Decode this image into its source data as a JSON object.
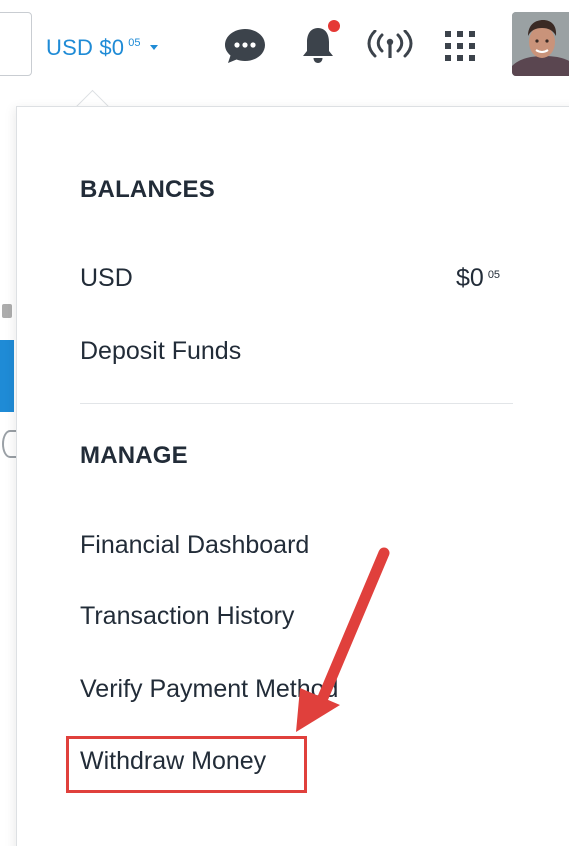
{
  "header": {
    "currency_label": "USD $0",
    "currency_cents": "05",
    "icons": [
      "chat-icon",
      "bell-icon",
      "signal-icon",
      "apps-icon",
      "avatar"
    ],
    "notification_dot_color": "#e53935"
  },
  "menu": {
    "balances_heading": "BALANCES",
    "usd_label": "USD",
    "usd_balance": "$0",
    "usd_balance_cents": "05",
    "deposit_label": "Deposit Funds",
    "manage_heading": "MANAGE",
    "items": [
      {
        "label": "Financial Dashboard"
      },
      {
        "label": "Transaction History"
      },
      {
        "label": "Verify Payment Method"
      },
      {
        "label": "Withdraw Money"
      }
    ]
  },
  "colors": {
    "accent": "#1f8bd6",
    "text": "#222c38",
    "annotation": "#e0403c"
  }
}
